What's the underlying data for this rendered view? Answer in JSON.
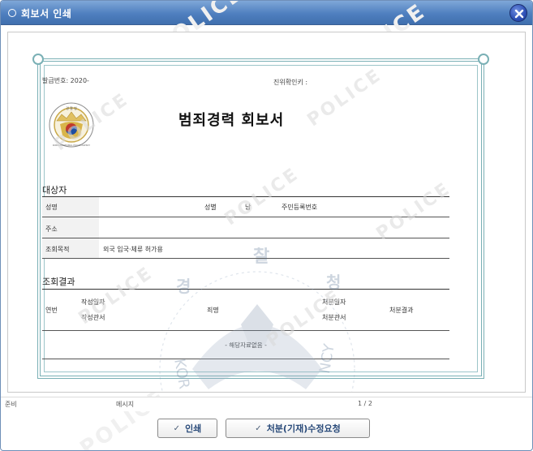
{
  "window": {
    "title": "회보서 인쇄"
  },
  "background_watermark": "POLICE",
  "document": {
    "issue_number": "발급번호: 2020-",
    "verify_label": "진위확인키 :",
    "seal_text": "경 찰 청",
    "seal_ring_text": "KOREAN NATIONAL POLICE AGENCY",
    "title": "범죄경력 회보서",
    "subject_section": "대상자",
    "name_label": "성명",
    "gender_label": "성별",
    "gender_value": "남",
    "rrn_label": "주민등록번호",
    "address_label": "주소",
    "purpose_label": "조회목적",
    "purpose_value": "외국 입국·체류 허가용",
    "result_section": "조회결과",
    "result_headers": {
      "no": "연번",
      "date_written": "작성일자",
      "office_written": "작성관서",
      "crime_name": "죄명",
      "disposition_date": "처분일자",
      "disposition_office": "처분관서",
      "disposition_result": "처분결과"
    },
    "no_records": "- 해당자료없음 -",
    "watermark_text": "POLICE",
    "emblem": {
      "top_char": "찰",
      "left_char": "경",
      "right_char": "청",
      "left_ring": "KOR",
      "right_ring": "NCY"
    }
  },
  "status": {
    "ready": "준비",
    "message": "메시지",
    "page": "1 / 2"
  },
  "buttons": {
    "print": "인쇄",
    "request_correction": "처분(기재)수정요청"
  },
  "colors": {
    "titlebar": "#4f7fbf",
    "frame": "#7ab0b5",
    "button_text": "#2a4b7a"
  }
}
